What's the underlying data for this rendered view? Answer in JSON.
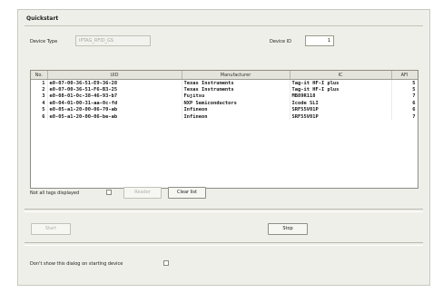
{
  "window": {
    "title": "Quickstart"
  },
  "device_type": {
    "label": "Device Type",
    "value": "IPTAG_RFID_GS"
  },
  "device_id": {
    "label": "Device ID",
    "value": "1"
  },
  "table": {
    "columns": [
      "No.",
      "UID",
      "Manufacturer",
      "IC",
      "AFI"
    ],
    "rows": [
      {
        "no": "1",
        "uid": "e0-07-00-36-51-E9-36-28",
        "manufacturer": "Texas Instruments",
        "ic": "Tag-it HF-I plus",
        "afi": "5"
      },
      {
        "no": "2",
        "uid": "e0-07-00-36-51-F6-B3-25",
        "manufacturer": "Texas Instruments",
        "ic": "Tag-it HF-I plus",
        "afi": "5"
      },
      {
        "no": "3",
        "uid": "e0-08-01-0c-38-46-93-b7",
        "manufacturer": "Fujitsu",
        "ic": "MB89R118",
        "afi": "7"
      },
      {
        "no": "4",
        "uid": "e0-04-01-00-31-aa-0c-fd",
        "manufacturer": "NXP Semiconductors",
        "ic": "Icode SLI",
        "afi": "6"
      },
      {
        "no": "5",
        "uid": "e0-05-a1-20-00-06-70-ab",
        "manufacturer": "Infineon",
        "ic": "SRF55V01P",
        "afi": "6"
      },
      {
        "no": "6",
        "uid": "e0-05-a1-20-00-06-be-ab",
        "manufacturer": "Infineon",
        "ic": "SRF55V01P",
        "afi": "7"
      }
    ]
  },
  "options": {
    "not_all_tags_label": "Not all tags displayed"
  },
  "buttons": {
    "reader": "Reader",
    "clear": "Clear list",
    "start": "Start",
    "stop": "Stop"
  },
  "footer": {
    "dont_show_label": "Don't show this dialog on starting device"
  }
}
